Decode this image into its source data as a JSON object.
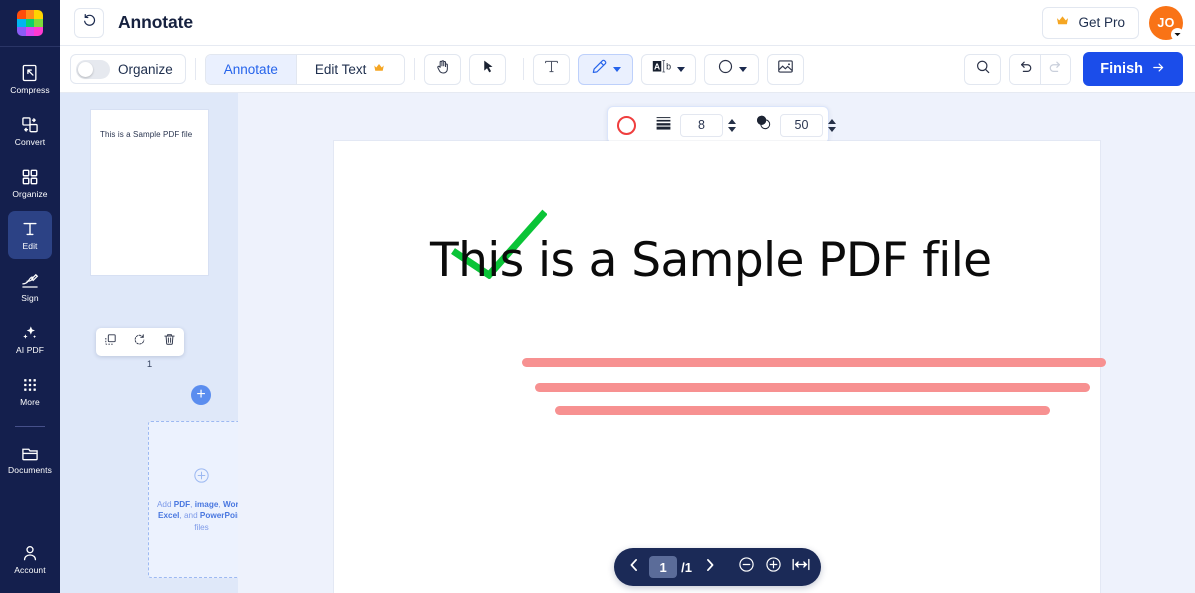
{
  "brand": {
    "logo_icon": "grid-logo-icon",
    "logo_colors": [
      "#ff4d0a",
      "#ff8c1a",
      "#ffd400",
      "#00b6f0",
      "#0ad16c",
      "#7ddb3a",
      "#8b5cf6",
      "#d946ef",
      "#ff3ad1"
    ],
    "accent": "#1b4dea",
    "rail_bg": "#141f4d",
    "canvas_bg": "#eef2fc",
    "thumb_panel_bg": "#dfe8f9"
  },
  "header": {
    "back_icon": "undo-rotate-icon",
    "title": "Annotate",
    "get_pro_label": "Get Pro",
    "get_pro_icon": "crown-icon",
    "avatar_initials": "JO",
    "avatar_color": "#f97316",
    "avatar_caret_icon": "chevron-down-icon"
  },
  "sidebar": {
    "items": [
      {
        "label": "Compress",
        "icon": "compress-icon",
        "active": false
      },
      {
        "label": "Convert",
        "icon": "convert-icon",
        "active": false
      },
      {
        "label": "Organize",
        "icon": "organize-grid-icon",
        "active": false
      },
      {
        "label": "Edit",
        "icon": "text-edit-icon",
        "active": true
      },
      {
        "label": "Sign",
        "icon": "signature-icon",
        "active": false
      },
      {
        "label": "AI PDF",
        "icon": "sparkles-icon",
        "active": false
      },
      {
        "label": "More",
        "icon": "dots-grid-icon",
        "active": false
      },
      {
        "label": "Documents",
        "icon": "folder-icon",
        "active": false
      }
    ],
    "bottom": {
      "label": "Account",
      "icon": "user-icon"
    }
  },
  "toolbar": {
    "organize_toggle": {
      "label": "Organize",
      "on": false
    },
    "mode_tabs": [
      {
        "label": "Annotate",
        "active": true,
        "badge_icon": null
      },
      {
        "label": "Edit Text",
        "active": false,
        "badge_icon": "crown-icon"
      }
    ],
    "tools": [
      {
        "name": "hand-tool",
        "icon": "hand-icon",
        "active": false,
        "has_caret": false
      },
      {
        "name": "select-tool",
        "icon": "cursor-arrow-icon",
        "active": false,
        "has_caret": false
      },
      {
        "name": "text-tool",
        "icon": "text-t-icon",
        "active": false,
        "has_caret": false
      },
      {
        "name": "draw-tool",
        "icon": "pen-highlighter-icon",
        "active": true,
        "has_caret": true
      },
      {
        "name": "highlight-text-tool",
        "icon": "text-highlight-ab-icon",
        "active": false,
        "has_caret": true
      },
      {
        "name": "shape-tool",
        "icon": "circle-shape-icon",
        "active": false,
        "has_caret": true
      },
      {
        "name": "image-tool",
        "icon": "image-add-icon",
        "active": false,
        "has_caret": false
      }
    ],
    "search_icon": "search-icon",
    "undo": {
      "icon": "undo-arrow-icon",
      "enabled": true
    },
    "redo": {
      "icon": "redo-arrow-icon",
      "enabled": false
    },
    "finish_label": "Finish",
    "finish_icon": "arrow-right-icon"
  },
  "properties_bar": {
    "color_swatch": {
      "icon": "color-circle-icon",
      "color": "#ef3e3e"
    },
    "thickness": {
      "icon": "line-thickness-icon",
      "value": "8"
    },
    "opacity": {
      "icon": "opacity-icon",
      "value": "50"
    },
    "stepper_up_icon": "triangle-up-icon",
    "stepper_down_icon": "triangle-down-icon"
  },
  "thumbnails": {
    "page": {
      "preview_text": "This is a Sample PDF file",
      "number": "1",
      "actions": [
        {
          "name": "duplicate-page",
          "icon": "duplicate-icon"
        },
        {
          "name": "rotate-page",
          "icon": "rotate-cw-icon"
        },
        {
          "name": "delete-page",
          "icon": "trash-icon"
        }
      ]
    },
    "add_page_button": {
      "icon": "plus-icon",
      "label": "+"
    },
    "dropzone": {
      "icon": "plus-circle-icon",
      "text_parts": [
        {
          "t": "Add ",
          "bold": false
        },
        {
          "t": "PDF",
          "bold": true
        },
        {
          "t": ", ",
          "bold": false
        },
        {
          "t": "image",
          "bold": true
        },
        {
          "t": ", ",
          "bold": false
        },
        {
          "t": "Word",
          "bold": true
        },
        {
          "t": ", ",
          "bold": false
        },
        {
          "t": "Excel",
          "bold": true
        },
        {
          "t": ", and ",
          "bold": false
        },
        {
          "t": "PowerPoint",
          "bold": true
        },
        {
          "t": " files",
          "bold": false
        }
      ]
    },
    "collapse_icon": "caret-left-icon"
  },
  "document": {
    "text": "This is a Sample PDF file",
    "annotations": [
      {
        "type": "checkmark",
        "color": "#0ac437"
      },
      {
        "type": "stroke",
        "color": "#f79191"
      },
      {
        "type": "stroke",
        "color": "#f79191"
      },
      {
        "type": "stroke",
        "color": "#f79191"
      }
    ]
  },
  "pager": {
    "prev_icon": "chevron-left-icon",
    "current_page": "1",
    "total_label": "/1",
    "next_icon": "chevron-right-icon",
    "zoom_out_icon": "minus-circle-icon",
    "zoom_in_icon": "plus-circle-icon",
    "fit_width_icon": "fit-width-icon"
  }
}
